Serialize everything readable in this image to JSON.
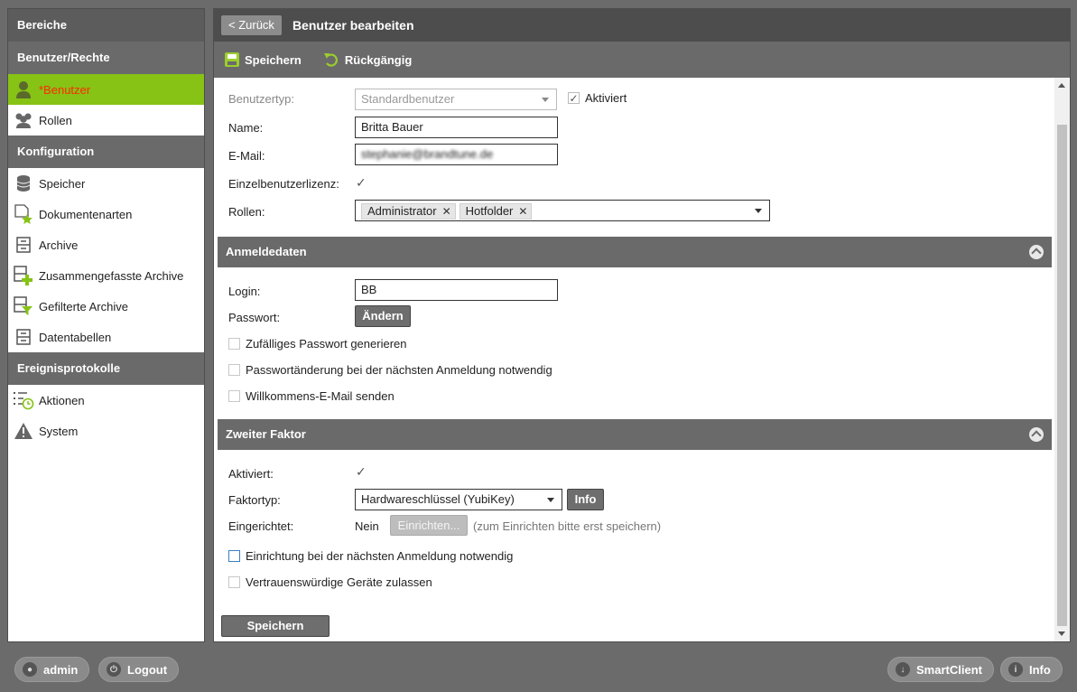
{
  "sidebar": {
    "header": "Bereiche",
    "sections": [
      {
        "title": "Benutzer/Rechte",
        "items": [
          {
            "label": "*Benutzer",
            "icon": "user-icon",
            "active": true
          },
          {
            "label": "Rollen",
            "icon": "group-icon"
          }
        ]
      },
      {
        "title": "Konfiguration",
        "items": [
          {
            "label": "Speicher",
            "icon": "database-icon"
          },
          {
            "label": "Dokumentenarten",
            "icon": "document-star-icon"
          },
          {
            "label": "Archive",
            "icon": "archive-icon"
          },
          {
            "label": "Zusammengefasste Archive",
            "icon": "archive-plus-icon"
          },
          {
            "label": "Gefilterte Archive",
            "icon": "archive-filter-icon"
          },
          {
            "label": "Datentabellen",
            "icon": "table-icon"
          }
        ]
      },
      {
        "title": "Ereignisprotokolle",
        "items": [
          {
            "label": "Aktionen",
            "icon": "list-clock-icon"
          },
          {
            "label": "System",
            "icon": "warning-icon"
          }
        ]
      }
    ]
  },
  "topbar": {
    "back_label": "< Zurück",
    "title": "Benutzer bearbeiten"
  },
  "toolbar": {
    "save_label": "Speichern",
    "undo_label": "Rückgängig"
  },
  "form": {
    "user_type_label": "Benutzertyp:",
    "user_type_value": "Standardbenutzer",
    "activated_label": "Aktiviert",
    "name_label": "Name:",
    "name_value": "Britta Bauer",
    "email_label": "E-Mail:",
    "email_value": "stephanie@brandtune.de",
    "single_license_label": "Einzelbenutzerlizenz:",
    "roles_label": "Rollen:",
    "roles": [
      "Administrator",
      "Hotfolder"
    ]
  },
  "login_section": {
    "title": "Anmeldedaten",
    "login_label": "Login:",
    "login_value": "BB",
    "password_label": "Passwort:",
    "change_button": "Ändern",
    "random_password": "Zufälliges Passwort generieren",
    "force_change": "Passwortänderung bei der nächsten Anmeldung notwendig",
    "welcome_mail": "Willkommens-E-Mail senden"
  },
  "second_factor": {
    "title": "Zweiter Faktor",
    "activated_label": "Aktiviert:",
    "factor_type_label": "Faktortyp:",
    "factor_type_value": "Hardwareschlüssel (YubiKey)",
    "info_button": "Info",
    "setup_label": "Eingerichtet:",
    "setup_value": "Nein",
    "setup_button": "Einrichten...",
    "setup_hint": "(zum Einrichten bitte erst speichern)",
    "setup_next_login": "Einrichtung bei der nächsten Anmeldung notwendig",
    "trusted_devices": "Vertrauenswürdige Geräte zulassen"
  },
  "save_button": "Speichern",
  "bottom": {
    "user": "admin",
    "logout": "Logout",
    "smartclient": "SmartClient",
    "info": "Info"
  }
}
